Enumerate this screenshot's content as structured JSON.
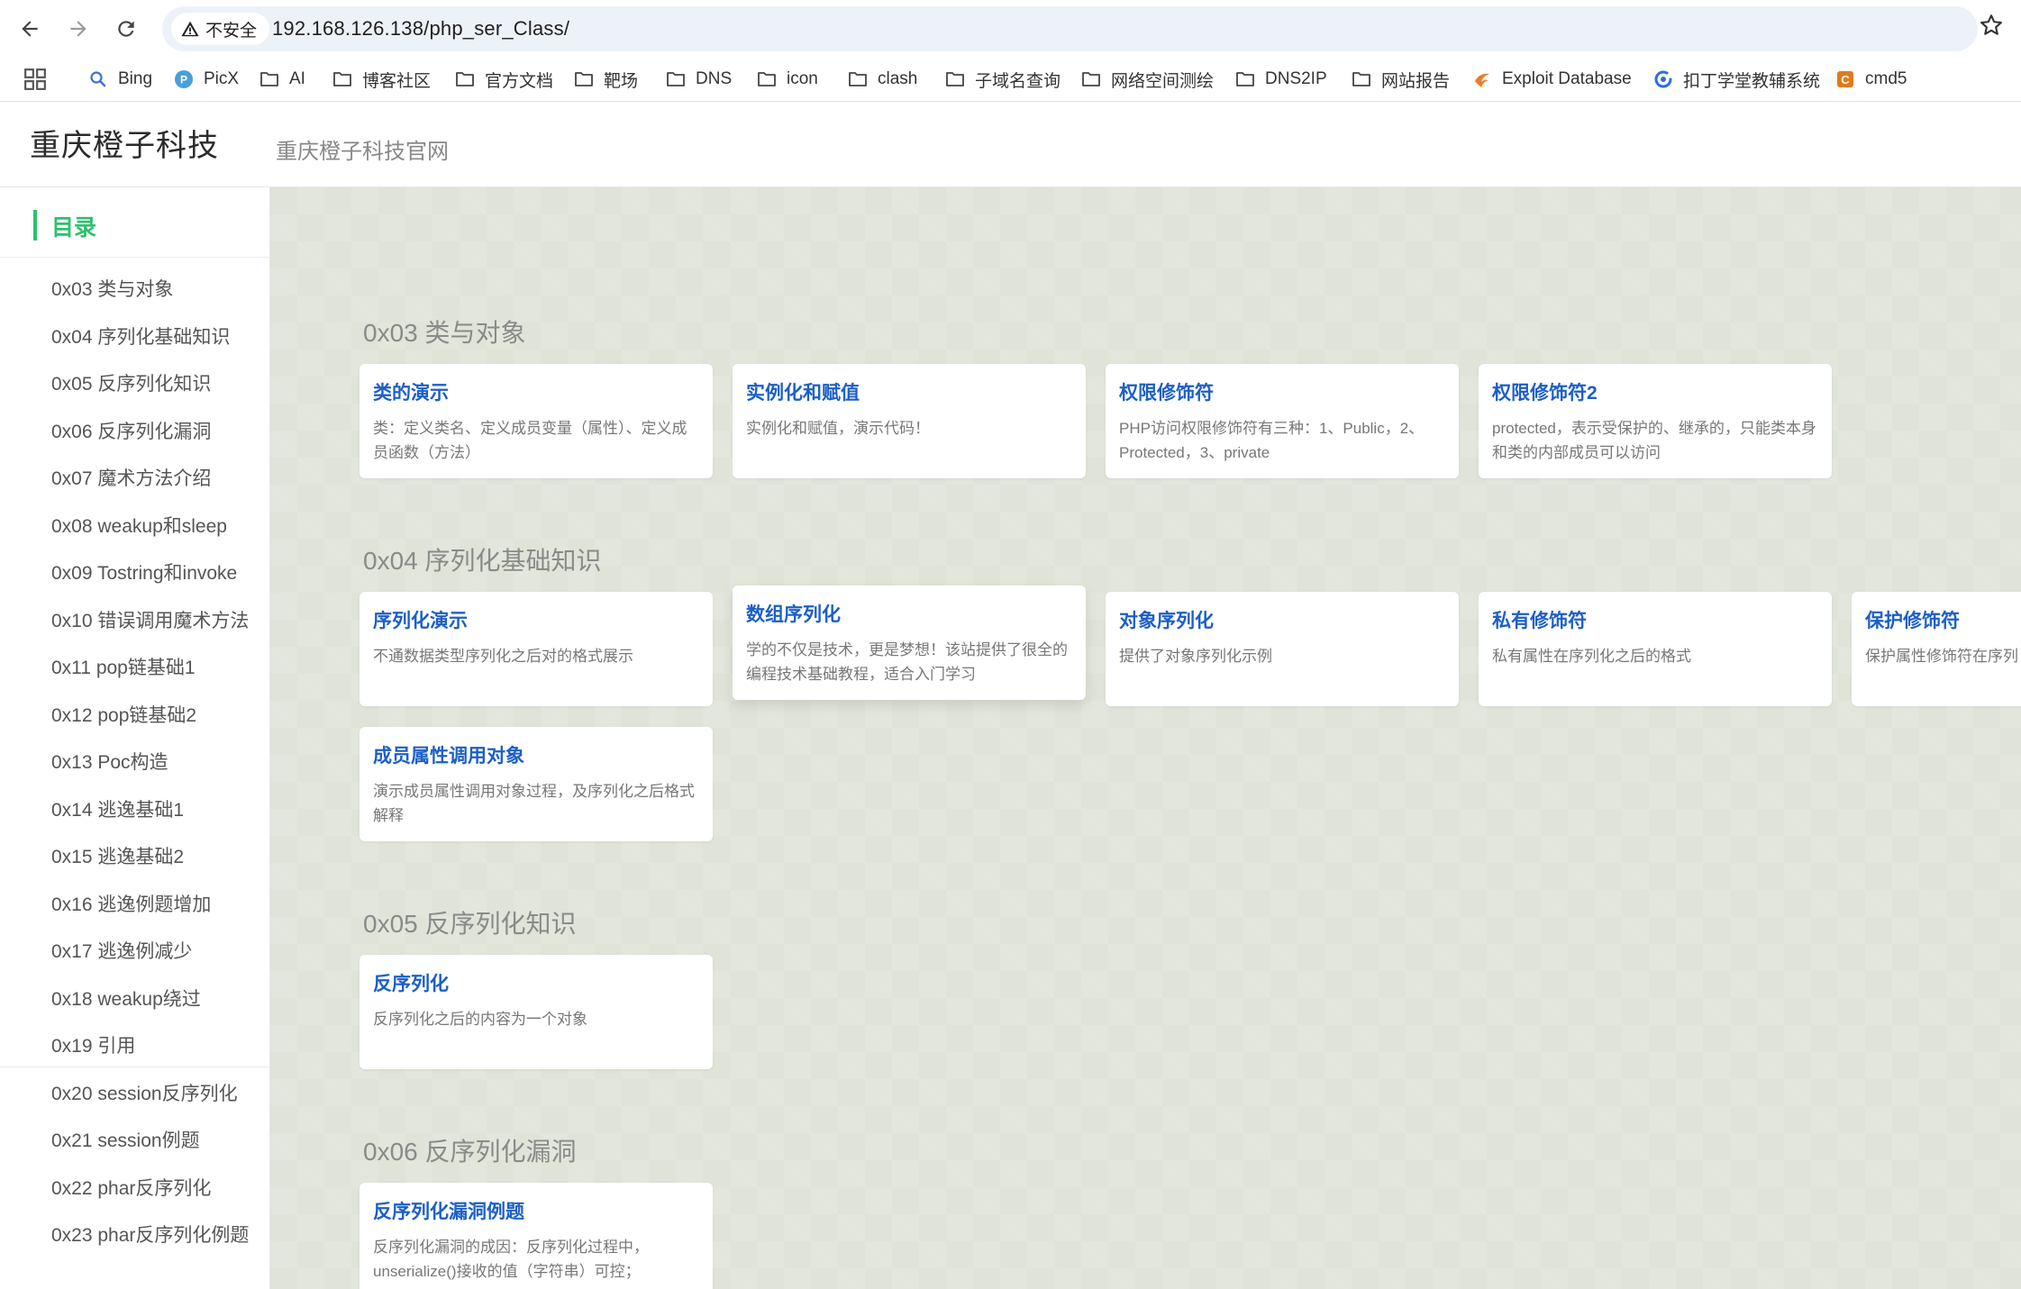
{
  "browser": {
    "security_label": "不安全",
    "url": "192.168.126.138/php_ser_Class/",
    "bookmarks": [
      {
        "label": "Bing",
        "icon": "search-icon"
      },
      {
        "label": "PicX",
        "icon": "picx-icon"
      },
      {
        "label": "AI",
        "icon": "folder-icon"
      },
      {
        "label": "博客社区",
        "icon": "folder-icon"
      },
      {
        "label": "官方文档",
        "icon": "folder-icon"
      },
      {
        "label": "靶场",
        "icon": "folder-icon"
      },
      {
        "label": "DNS",
        "icon": "folder-icon"
      },
      {
        "label": "icon",
        "icon": "folder-icon"
      },
      {
        "label": "clash",
        "icon": "folder-icon"
      },
      {
        "label": "子域名查询",
        "icon": "folder-icon"
      },
      {
        "label": "网络空间测绘",
        "icon": "folder-icon"
      },
      {
        "label": "DNS2IP",
        "icon": "folder-icon"
      },
      {
        "label": "网站报告",
        "icon": "folder-icon"
      },
      {
        "label": "Exploit Database",
        "icon": "exploit-db-icon"
      },
      {
        "label": "扣丁学堂教辅系统",
        "icon": "koudin-icon"
      },
      {
        "label": "cmd5",
        "icon": "cmd5-icon"
      }
    ]
  },
  "site": {
    "brand": "重庆橙子科技",
    "tagline": "重庆橙子科技官网"
  },
  "toc": {
    "title": "目录",
    "items": [
      "0x03 类与对象",
      "0x04 序列化基础知识",
      "0x05 反序列化知识",
      "0x06 反序列化漏洞",
      "0x07 魔术方法介绍",
      "0x08 weakup和sleep",
      "0x09 Tostring和invoke",
      "0x10 错误调用魔术方法",
      "0x11 pop链基础1",
      "0x12 pop链基础2",
      "0x13 Poc构造",
      "0x14 逃逸基础1",
      "0x15 逃逸基础2",
      "0x16 逃逸例题增加",
      "0x17 逃逸例减少",
      "0x18 weakup绕过",
      "0x19 引用",
      "0x20 session反序列化",
      "0x21 session例题",
      "0x22 phar反序列化",
      "0x23 phar反序列化例题"
    ]
  },
  "sections": [
    {
      "title": "0x03 类与对象",
      "cards": [
        {
          "title": "类的演示",
          "desc": "类：定义类名、定义成员变量（属性）、定义成员函数（方法）"
        },
        {
          "title": "实例化和赋值",
          "desc": "实例化和赋值，演示代码！"
        },
        {
          "title": "权限修饰符",
          "desc": "PHP访问权限修饰符有三种：1、Public，2、Protected，3、private"
        },
        {
          "title": "权限修饰符2",
          "desc": "protected，表示受保护的、继承的，只能类本身和类的内部成员可以访问"
        }
      ]
    },
    {
      "title": "0x04 序列化基础知识",
      "cards": [
        {
          "title": "序列化演示",
          "desc": "不通数据类型序列化之后对的格式展示"
        },
        {
          "title": "数组序列化",
          "desc": "学的不仅是技术，更是梦想！该站提供了很全的编程技术基础教程，适合入门学习"
        },
        {
          "title": "对象序列化",
          "desc": "提供了对象序列化示例"
        },
        {
          "title": "私有修饰符",
          "desc": "私有属性在序列化之后的格式"
        },
        {
          "title": "保护修饰符",
          "desc": "保护属性修饰符在序列"
        },
        {
          "title": "成员属性调用对象",
          "desc": "演示成员属性调用对象过程，及序列化之后格式解释"
        }
      ]
    },
    {
      "title": "0x05 反序列化知识",
      "cards": [
        {
          "title": "反序列化",
          "desc": "反序列化之后的内容为一个对象"
        }
      ]
    },
    {
      "title": "0x06 反序列化漏洞",
      "cards": [
        {
          "title": "反序列化漏洞例题",
          "desc": "反序列化漏洞的成因：反序列化过程中，unserialize()接收的值（字符串）可控；"
        }
      ]
    }
  ]
}
